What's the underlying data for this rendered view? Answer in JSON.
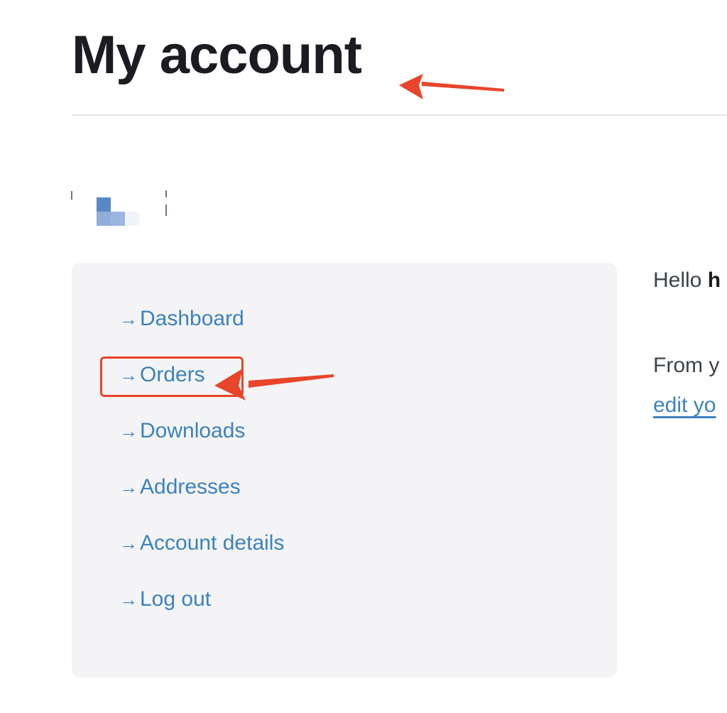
{
  "page": {
    "title": "My account"
  },
  "nav": {
    "arrow": "→",
    "items": [
      {
        "label": "Dashboard"
      },
      {
        "label": "Orders"
      },
      {
        "label": "Downloads"
      },
      {
        "label": "Addresses"
      },
      {
        "label": "Account details"
      },
      {
        "label": "Log out"
      }
    ]
  },
  "content": {
    "greeting_prefix": "Hello ",
    "greeting_name": "h",
    "intro_text": "From y",
    "edit_link": "edit yo"
  },
  "colors": {
    "link": "#3b82be",
    "heading": "#1a1c21",
    "nav_background": "#f4f4f6",
    "annotation": "#e8452a"
  }
}
